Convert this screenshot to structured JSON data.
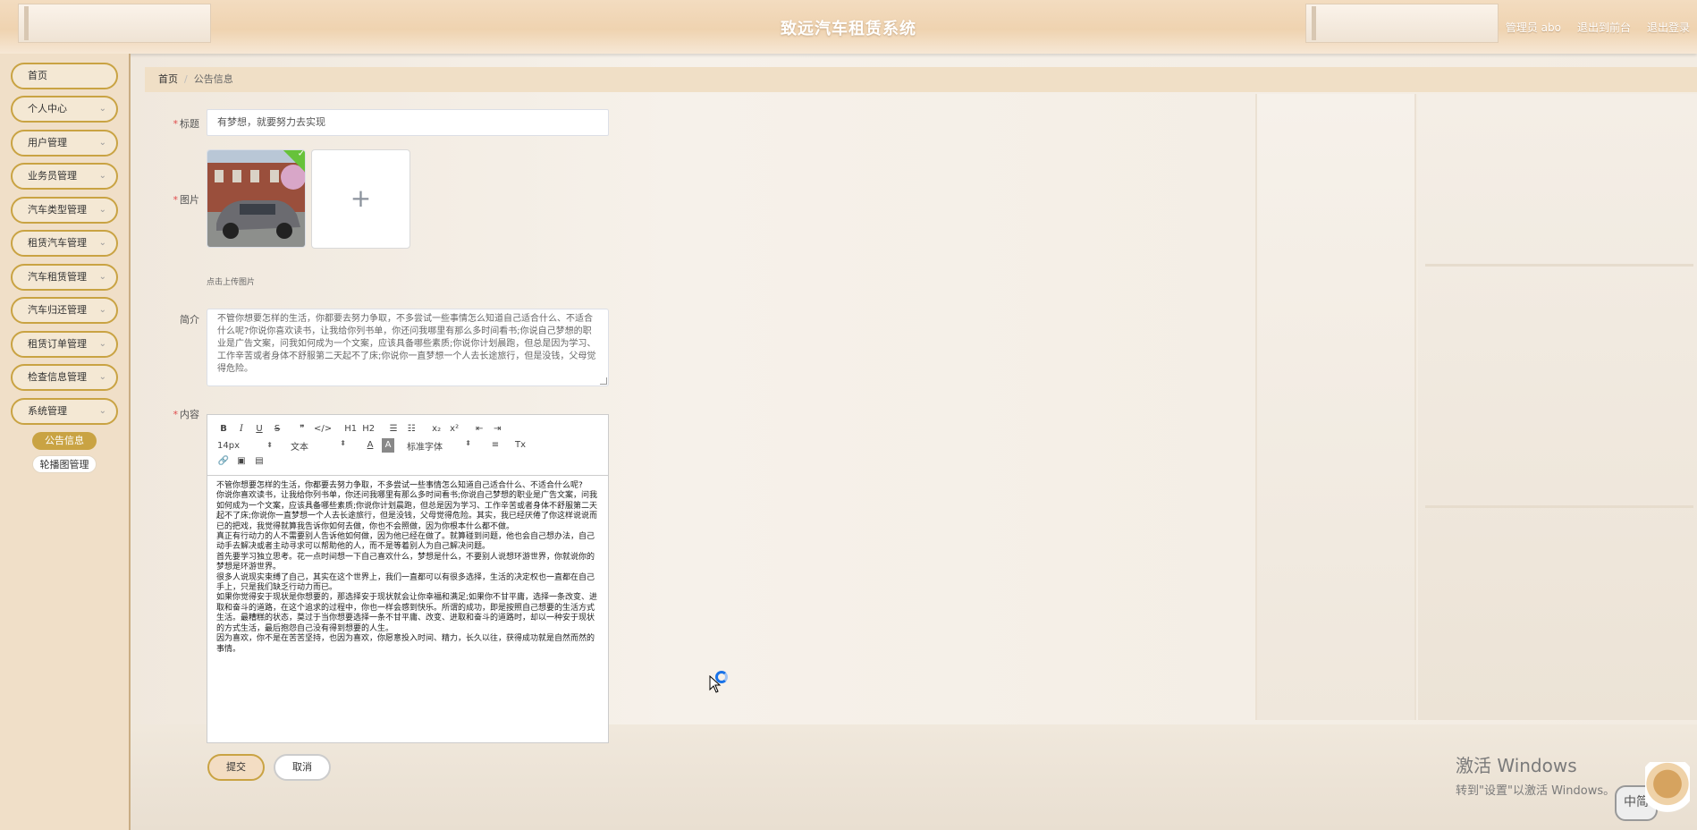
{
  "app": {
    "title": "致远汽车租赁系统",
    "header_links": [
      "管理员 abo",
      "退出到前台",
      "退出登录"
    ]
  },
  "sidebar": {
    "items": [
      {
        "label": "首页",
        "expandable": false
      },
      {
        "label": "个人中心",
        "expandable": true
      },
      {
        "label": "用户管理",
        "expandable": true
      },
      {
        "label": "业务员管理",
        "expandable": true
      },
      {
        "label": "汽车类型管理",
        "expandable": true
      },
      {
        "label": "租赁汽车管理",
        "expandable": true
      },
      {
        "label": "汽车租赁管理",
        "expandable": true
      },
      {
        "label": "汽车归还管理",
        "expandable": true
      },
      {
        "label": "租赁订单管理",
        "expandable": true
      },
      {
        "label": "检查信息管理",
        "expandable": true
      },
      {
        "label": "系统管理",
        "expandable": true
      }
    ],
    "sub_items": [
      {
        "label": "公告信息",
        "active": true
      },
      {
        "label": "轮播图管理",
        "active": false
      }
    ]
  },
  "breadcrumb": {
    "home": "首页",
    "current": "公告信息"
  },
  "form": {
    "title_label": "标题",
    "title_value": "有梦想，就要努力去实现",
    "image_label": "图片",
    "upload_hint": "点击上传图片",
    "upload_plus": "+",
    "upload_success": "✓",
    "intro_label": "简介",
    "intro_value": "不管你想要怎样的生活，你都要去努力争取，不多尝试一些事情怎么知道自己适合什么、不适合什么呢?你说你喜欢读书，让我给你列书单，你还问我哪里有那么多时间看书;你说自己梦想的职业是广告文案，问我如何成为一个文案，应该具备哪些素质;你说你计划晨跑，但总是因为学习、工作辛苦或者身体不舒服第二天起不了床;你说你一直梦想一个人去长途旅行，但是没钱，父母觉得危险。",
    "content_label": "内容",
    "submit": "提交",
    "cancel": "取消"
  },
  "editor": {
    "toolbar_row1": [
      "B",
      "I",
      "U",
      "S",
      "❞",
      "</>",
      "H1",
      "H2",
      "☰",
      "☷",
      "x₂",
      "x²",
      "⇤",
      "⇥"
    ],
    "font_size": "14px",
    "text_type": "文本",
    "font_family": "标准字体",
    "toolbar_row2_icons": [
      "A",
      "A",
      "≡",
      "Tx"
    ],
    "toolbar_row3": [
      "🔗",
      "▣",
      "▤"
    ],
    "paragraphs": [
      "不管你想要怎样的生活，你都要去努力争取，不多尝试一些事情怎么知道自己适合什么、不适合什么呢?",
      "你说你喜欢读书，让我给你列书单，你还问我哪里有那么多时间看书;你说自己梦想的职业是广告文案，问我如何成为一个文案，应该具备哪些素质;你说你计划晨跑，但总是因为学习、工作辛苦或者身体不舒服第二天起不了床;你说你一直梦想一个人去长途旅行，但是没钱，父母觉得危险。其实，我已经厌倦了你这样说说而已的把戏，我觉得就算我告诉你如何去做，你也不会照做，因为你根本什么都不做。",
      "真正有行动力的人不需要别人告诉他如何做，因为他已经在做了。就算碰到问题，他也会自己想办法，自己动手去解决或者主动寻求可以帮助他的人，而不是等着别人为自己解决问题。",
      "首先要学习独立思考。花一点时间想一下自己喜欢什么，梦想是什么，不要别人说想环游世界，你就说你的梦想是环游世界。",
      "很多人说现实束缚了自己，其实在这个世界上，我们一直都可以有很多选择，生活的决定权也一直都在自己手上，只是我们缺乏行动力而已。",
      "如果你觉得安于现状是你想要的，那选择安于现状就会让你幸福和满足;如果你不甘平庸，选择一条改变、进取和奋斗的道路，在这个追求的过程中，你也一样会感到快乐。所谓的成功，即是按照自己想要的生活方式生活。最糟糕的状态，莫过于当你想要选择一条不甘平庸、改变、进取和奋斗的道路时，却以一种安于现状的方式生活，最后抱怨自己没有得到想要的人生。",
      "因为喜欢，你不是在苦苦坚持，也因为喜欢，你愿意投入时间、精力，长久以往，获得成功就是自然而然的事情。"
    ]
  },
  "overlay": {
    "activate_line1": "激活 Windows",
    "activate_line2": "转到\"设置\"以激活 Windows。",
    "ime_label": "中简"
  },
  "colors": {
    "accent": "#c9a343",
    "header_bg": "#efd3b0",
    "sidebar_bg": "#f0dfc8",
    "required": "#e04b4b"
  }
}
